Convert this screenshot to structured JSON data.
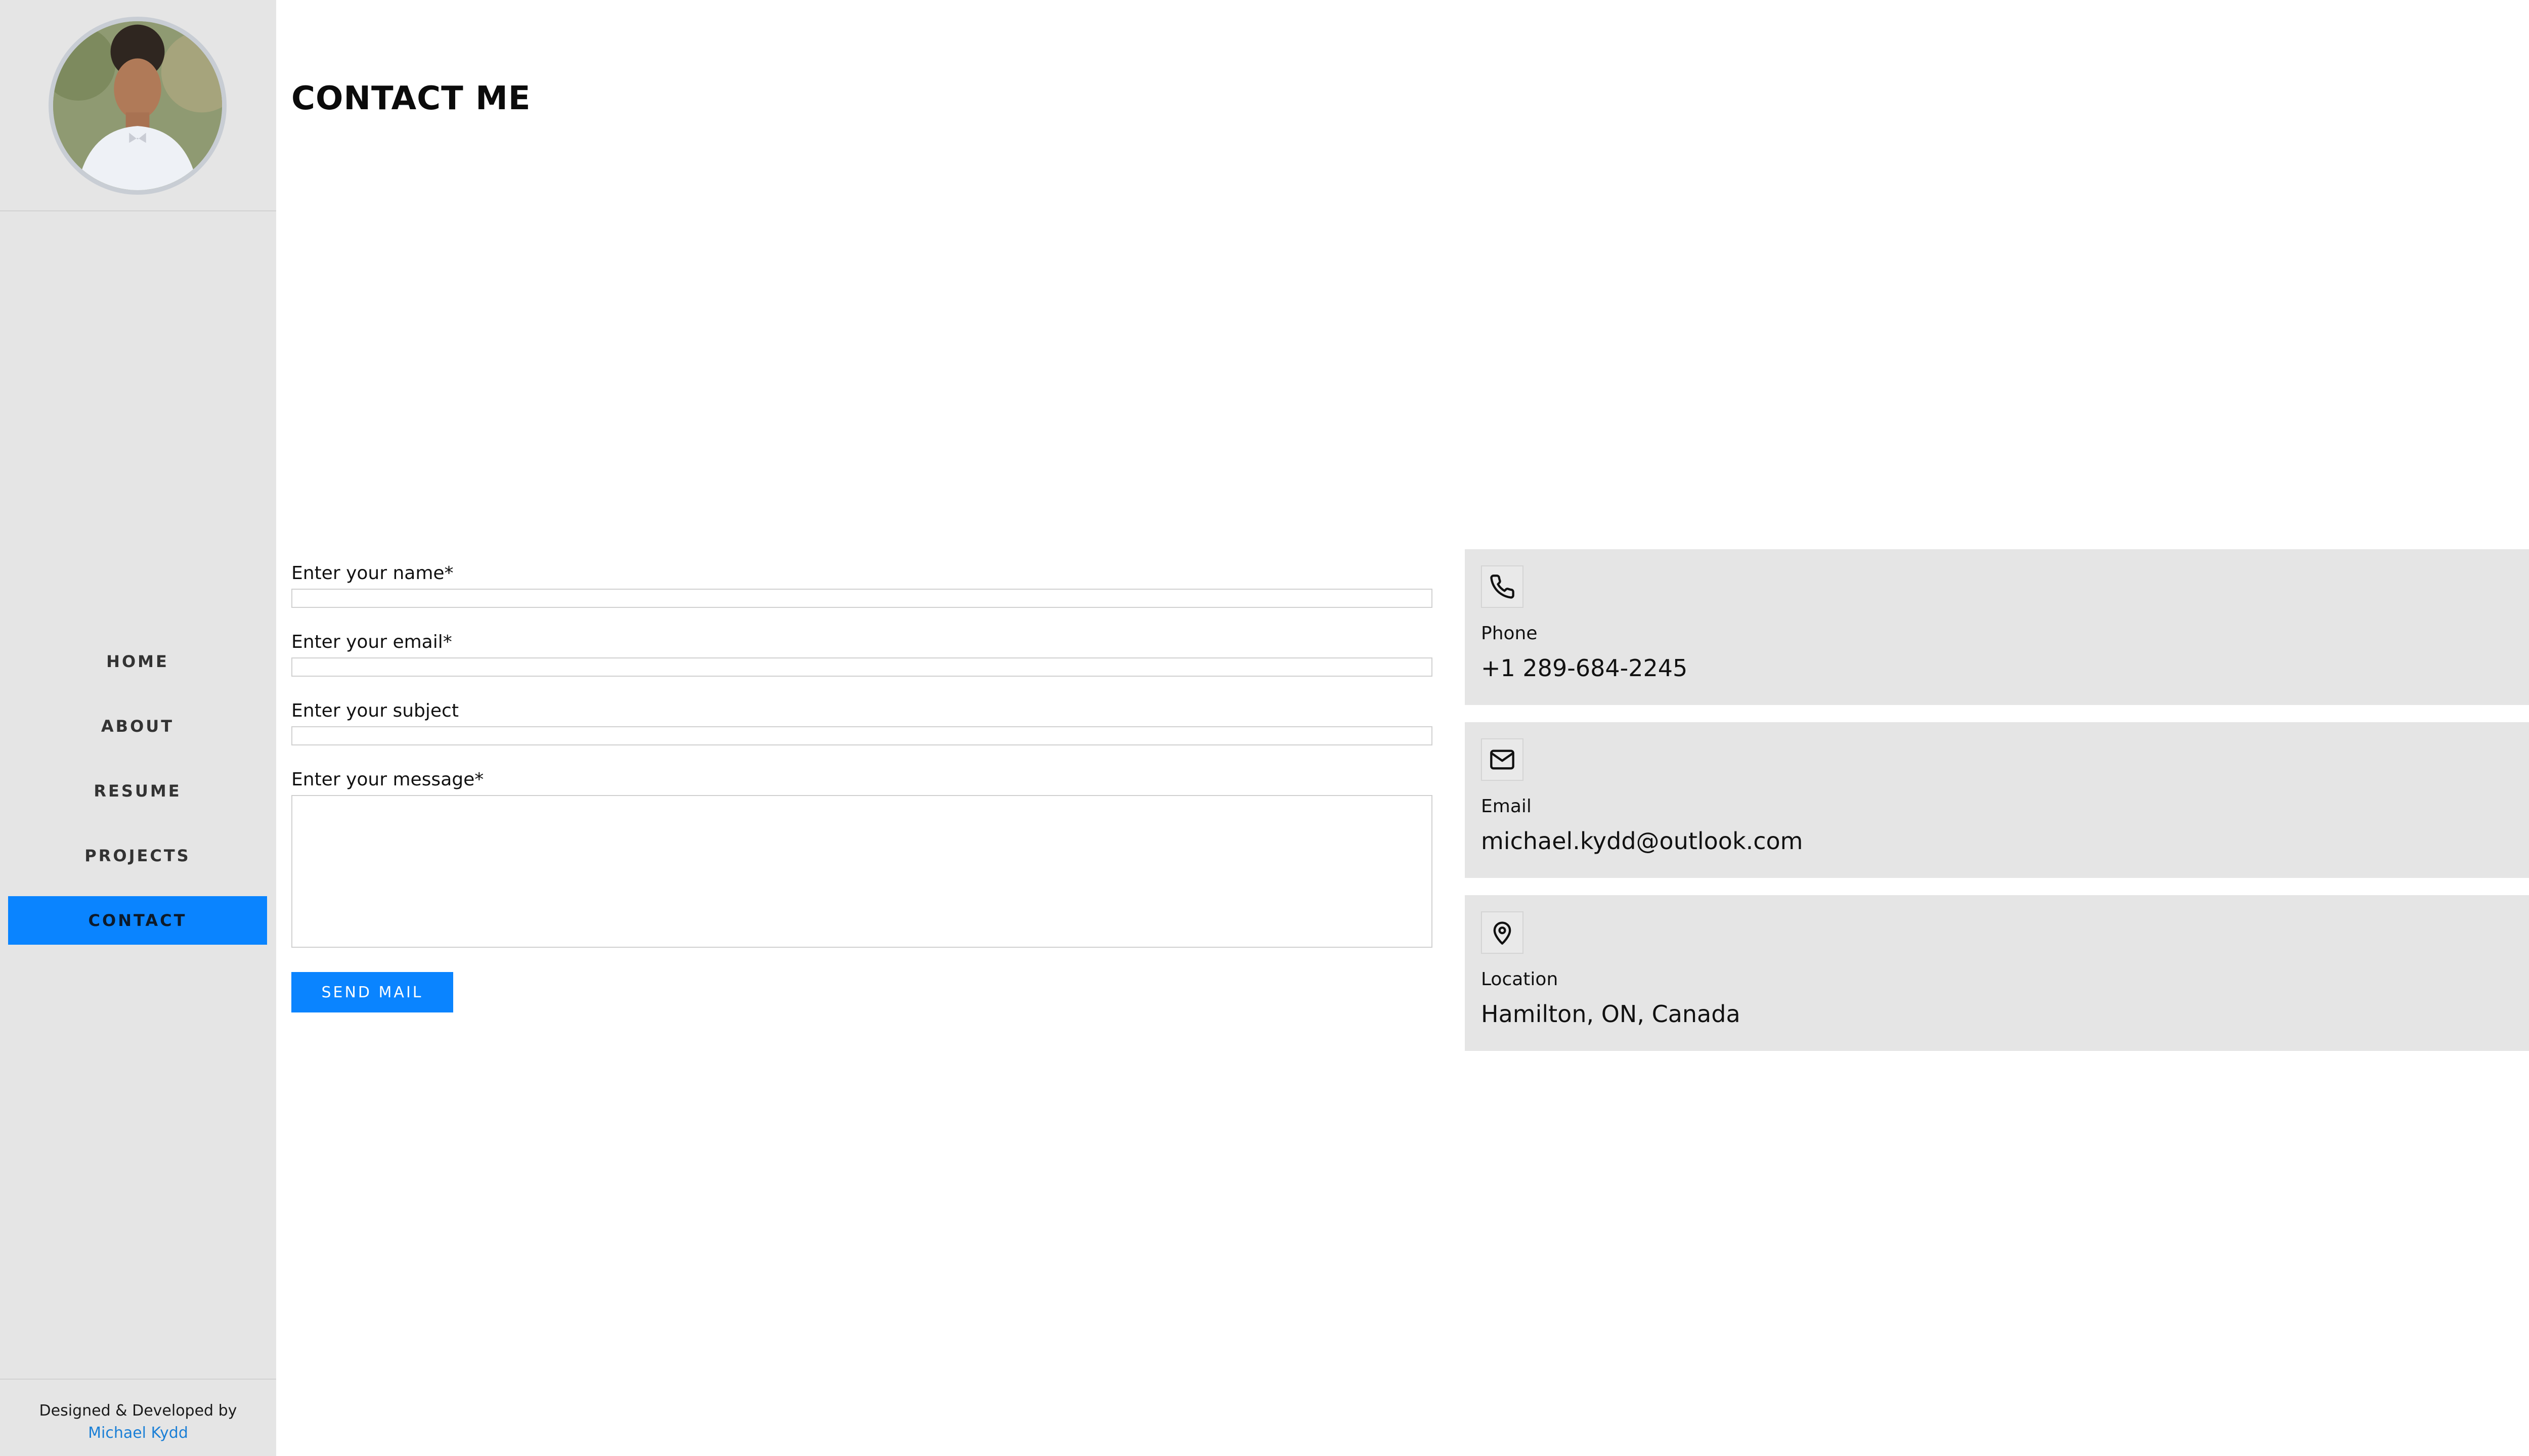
{
  "sidebar": {
    "profile_alt": "Michael Kydd profile photo",
    "nav": [
      {
        "label": "HOME"
      },
      {
        "label": "ABOUT"
      },
      {
        "label": "RESUME"
      },
      {
        "label": "PROJECTS"
      },
      {
        "label": "CONTACT",
        "active": true
      }
    ],
    "footer": {
      "credit": "Designed & Developed by",
      "author": "Michael Kydd"
    }
  },
  "main": {
    "title": "CONTACT ME",
    "form": {
      "name_label": "Enter your name*",
      "name_value": "",
      "email_label": "Enter your email*",
      "email_value": "",
      "subject_label": "Enter your subject",
      "subject_value": "",
      "message_label": "Enter your message*",
      "message_value": "",
      "submit_label": "SEND MAIL"
    },
    "contact_cards": [
      {
        "icon": "phone-icon",
        "label": "Phone",
        "value": "+1 289-684-2245"
      },
      {
        "icon": "mail-icon",
        "label": "Email",
        "value": "michael.kydd@outlook.com"
      },
      {
        "icon": "location-pin-icon",
        "label": "Location",
        "value": "Hamilton, ON, Canada"
      }
    ]
  },
  "colors": {
    "accent": "#0a84ff",
    "sidebar_bg": "#e5e5e5",
    "card_bg": "#e5e5e5",
    "link": "#1a7fd6"
  }
}
